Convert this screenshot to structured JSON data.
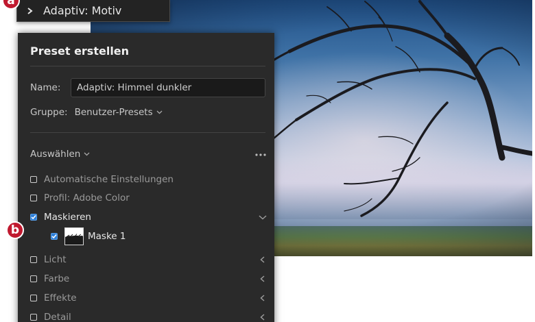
{
  "top_panel": {
    "label": "Adaptiv: Motiv"
  },
  "dialog": {
    "title": "Preset erstellen",
    "name_label": "Name:",
    "name_value": "Adaptiv: Himmel dunkler",
    "group_label": "Gruppe:",
    "group_value": "Benutzer-Presets",
    "select_label": "Auswählen",
    "items": [
      {
        "label": "Automatische Einstellungen",
        "checked": false
      },
      {
        "label": "Profil: Adobe Color",
        "checked": false
      },
      {
        "label": "Maskieren",
        "checked": true
      },
      {
        "label": "Maske 1",
        "checked": true
      },
      {
        "label": "Licht",
        "checked": false
      },
      {
        "label": "Farbe",
        "checked": false
      },
      {
        "label": "Effekte",
        "checked": false
      },
      {
        "label": "Detail",
        "checked": false
      }
    ]
  },
  "badges": {
    "a": "a",
    "b": "b"
  },
  "colors": {
    "panel_bg": "#2a2a2a",
    "accent_checkbox": "#2d7fd8",
    "badge": "#c0192f"
  }
}
